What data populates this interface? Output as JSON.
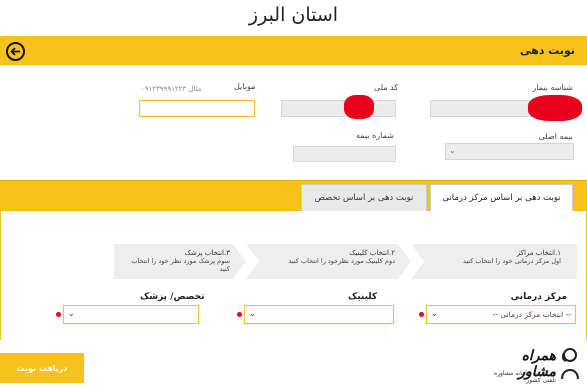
{
  "page_title": "استان البرز",
  "header": {
    "title": "نوبت دهی"
  },
  "form": {
    "patient_id_label": "شناسه بیمار",
    "national_code_label": "کد ملی",
    "mobile_label": "موبایل",
    "mobile_example": "مثال ۰۹۱۲۳۹۹۹۱۲۲۴",
    "primary_insurance_label": "بیمه اصلی",
    "insurance_number_label": "شماره بیمه"
  },
  "tabs": [
    {
      "label": "نوبت دهی بر اساس مرکز درمانی",
      "active": true
    },
    {
      "label": "نوبت دهی بر اساس تخصص",
      "active": false
    }
  ],
  "steps": [
    {
      "title": "۱.انتخاب مراکز",
      "desc": "اول مرکز درمانی خود را انتخاب کنید"
    },
    {
      "title": "۲.انتخاب کلینیک",
      "desc": "دوم کلینیک مورد نظرخود را انتخاب کنید"
    },
    {
      "title": "۳.انتخاب پزشک",
      "desc": "سوم پزشک مورد نظر خود را انتخاب کنید"
    }
  ],
  "selects": {
    "center_label": "مرکز درمانی",
    "center_value": "-- انتخاب مرکز درمانی --",
    "clinic_label": "کلینیک",
    "doctor_label": "تخصص/ پزشک"
  },
  "submit_label": "دریافت نوبت",
  "logo": {
    "name": "همراه مشاور",
    "tagline": "بزرگترین سامانه مشاوره تلفنی کشور"
  },
  "colors": {
    "accent": "#f7c21b",
    "required": "#e8001c"
  }
}
